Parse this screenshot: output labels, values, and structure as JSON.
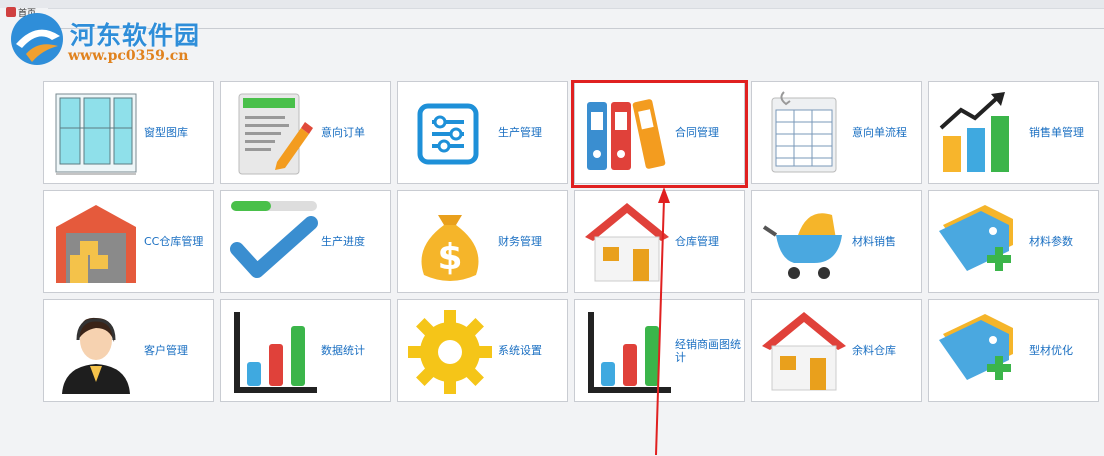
{
  "tabs": [
    {
      "label": "首页"
    }
  ],
  "watermark": {
    "title": "河东软件园",
    "url": "www.pc0359.cn"
  },
  "tiles": [
    {
      "label": "窗型图库",
      "icon": "window-frame-icon"
    },
    {
      "label": "意向订单",
      "icon": "notepad-pencil-icon"
    },
    {
      "label": "生产管理",
      "icon": "sliders-icon"
    },
    {
      "label": "合同管理",
      "icon": "binders-icon"
    },
    {
      "label": "意向单流程",
      "icon": "spreadsheet-icon"
    },
    {
      "label": "销售单管理",
      "icon": "growth-chart-icon"
    },
    {
      "label": "CC仓库管理",
      "icon": "warehouse-icon"
    },
    {
      "label": "生产进度",
      "icon": "checkmark-progress-icon"
    },
    {
      "label": "财务管理",
      "icon": "money-bag-icon"
    },
    {
      "label": "仓库管理",
      "icon": "house-icon"
    },
    {
      "label": "材料销售",
      "icon": "cart-icon"
    },
    {
      "label": "材料参数",
      "icon": "tag-add-icon"
    },
    {
      "label": "客户管理",
      "icon": "headset-person-icon"
    },
    {
      "label": "数据统计",
      "icon": "bar-chart-icon"
    },
    {
      "label": "系统设置",
      "icon": "gear-icon"
    },
    {
      "label": "经销商画图统计",
      "icon": "bar-chart-icon"
    },
    {
      "label": "余料仓库",
      "icon": "house-icon"
    },
    {
      "label": "型材优化",
      "icon": "tag-add-icon"
    }
  ],
  "colors": {
    "accent": "#1a6fc2",
    "highlight": "#e02020"
  }
}
